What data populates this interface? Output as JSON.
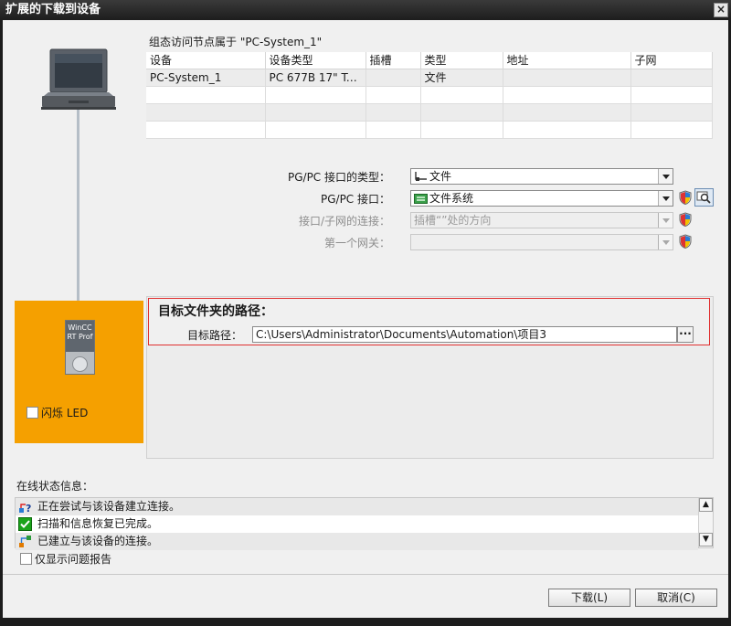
{
  "window": {
    "title": "扩展的下载到设备",
    "close_glyph": "×"
  },
  "device_panel": {
    "device_label_line1": "WinCC",
    "device_label_line2": "RT Prof",
    "flash_led_label": "闪烁 LED",
    "flash_led_checked": false
  },
  "access_nodes": {
    "caption": "组态访问节点属于 \"PC-System_1\"",
    "columns": [
      "设备",
      "设备类型",
      "插槽",
      "类型",
      "地址",
      "子网"
    ],
    "rows": [
      [
        "PC-System_1",
        "PC 677B 17\" Tou...",
        "",
        "文件",
        "",
        ""
      ],
      [
        "",
        "",
        "",
        "",
        "",
        ""
      ],
      [
        "",
        "",
        "",
        "",
        "",
        ""
      ],
      [
        "",
        "",
        "",
        "",
        "",
        ""
      ]
    ]
  },
  "interface": {
    "type_label": "PG/PC 接口的类型：",
    "type_value": "文件",
    "iface_label": "PG/PC 接口：",
    "iface_value": "文件系统",
    "conn_label": "接口/子网的连接：",
    "conn_value": "插槽“”处的方向",
    "gateway_label": "第一个网关：",
    "gateway_value": ""
  },
  "target": {
    "heading": "目标文件夹的路径：",
    "path_label": "目标路径：",
    "path_value": "C:\\Users\\Administrator\\Documents\\Automation\\项目3",
    "browse_glyph": "···"
  },
  "status": {
    "heading": "在线状态信息：",
    "messages": [
      "正在尝试与该设备建立连接。",
      "扫描和信息恢复已完成。",
      "已建立与该设备的连接。"
    ],
    "only_errors_label": "仅显示问题报告",
    "only_errors_checked": false
  },
  "buttons": {
    "download": "下载(L)",
    "cancel": "取消(C)"
  },
  "colors": {
    "accent_orange": "#f5a000",
    "highlight_red": "#e03030",
    "ok_green": "#1aa31a"
  }
}
